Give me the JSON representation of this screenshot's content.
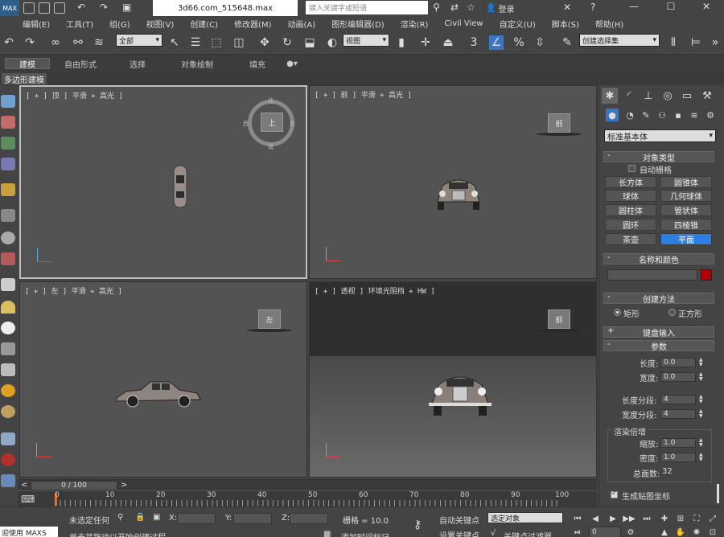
{
  "titlebar": {
    "logo": "MAX",
    "file_title": "3d66.com_515648.max",
    "search_placeholder": "键入关键字或短语",
    "login": "登录",
    "minimize": "—",
    "maximize": "☐",
    "close": "✕"
  },
  "menu": [
    "编辑(E)",
    "工具(T)",
    "组(G)",
    "视图(V)",
    "创建(C)",
    "修改器(M)",
    "动画(A)",
    "图形编辑器(D)",
    "渲染(R)",
    "Civil View",
    "自定义(U)",
    "脚本(S)",
    "帮助(H)"
  ],
  "toolbar": {
    "filter_select": "全部",
    "refcoord_select": "视图",
    "snap_label": "3",
    "selset_select": "创建选择集"
  },
  "ribbon": {
    "tabs": [
      "建模",
      "自由形式",
      "选择",
      "对象绘制",
      "填充"
    ],
    "active_tab": "建模",
    "sub_tab": "多边形建模"
  },
  "viewports": {
    "top": {
      "label": "[ + ] 顶 ] 平滑 + 高光 ]",
      "cube_label": "上",
      "compass_n": "北",
      "compass_s": "南",
      "compass_e": "东",
      "compass_w": "西"
    },
    "front": {
      "label": "[ + ] 前 ] 平滑 + 高光 ]",
      "cube_label": "前"
    },
    "left": {
      "label": "[ + ] 左 ] 平滑 + 高光 ]",
      "cube_label": "左"
    },
    "persp": {
      "label": "[ + ] 透视 ] 环境光阻挡 + HW ]",
      "cube_label": "前"
    }
  },
  "command_panel": {
    "category_select": "标准基本体",
    "object_type_title": "对象类型",
    "autogrid_label": "自动栅格",
    "object_buttons": [
      "长方体",
      "圆锥体",
      "球体",
      "几何球体",
      "圆柱体",
      "管状体",
      "圆环",
      "四棱锥",
      "茶壶",
      "平面"
    ],
    "selected_button": "平面",
    "name_color_title": "名称和颜色",
    "swatch_color": "#b40000",
    "creation_method_title": "创建方法",
    "method_rect": "矩形",
    "method_square": "正方形",
    "keyboard_input_title": "键盘输入",
    "params_title": "参数",
    "length_label": "长度:",
    "length_value": "0.0",
    "width_label": "宽度:",
    "width_value": "0.0",
    "length_segs_label": "长度分段:",
    "length_segs_value": "4",
    "width_segs_label": "宽度分段:",
    "width_segs_value": "4",
    "render_mult_title": "渲染倍增",
    "scale_label": "缩放:",
    "scale_value": "1.0",
    "density_label": "密度:",
    "density_value": "1.0",
    "total_faces_label": "总面数:",
    "total_faces_value": "32",
    "gen_map_label": "生成贴图坐标"
  },
  "timeline": {
    "frame_display": "0 / 100",
    "prev_label": "<",
    "next_label": ">",
    "ticks": [
      "0",
      "10",
      "20",
      "30",
      "40",
      "50",
      "60",
      "70",
      "80",
      "90",
      "100"
    ]
  },
  "statusbar": {
    "maxscript_label": "迎使用 MAXS",
    "selection_status": "未选定任何",
    "x_label": "X:",
    "y_label": "Y:",
    "z_label": "Z:",
    "grid_label": "栅格 = 10.0",
    "auto_key": "自动关键点",
    "set_key": "设置关键点",
    "selected_object": "选定对象",
    "key_filters": "关键点过滤器...",
    "prompt": "单击并拖动以开始创建过程",
    "add_time_tag": "添加时间标记",
    "frame_field": "0"
  }
}
